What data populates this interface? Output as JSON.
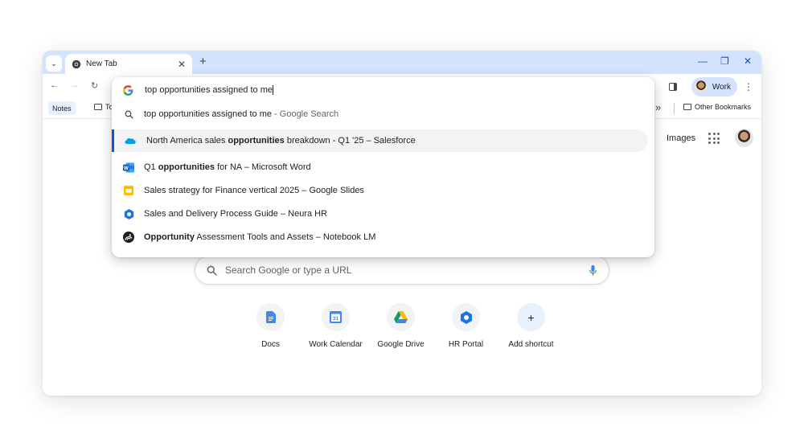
{
  "tabstrip": {
    "tab_title": "New Tab",
    "close_glyph": "✕",
    "new_tab_glyph": "+",
    "window_controls": [
      "—",
      "❐",
      "✕"
    ]
  },
  "toolbar": {
    "profile_label": "Work"
  },
  "bookmarks": {
    "notes_label": "Notes",
    "folder_partial": "To",
    "overflow": "»",
    "other_bookmarks": "Other Bookmarks"
  },
  "omnibox": {
    "query": "top opportunities assigned to me",
    "suggestions": [
      {
        "icon": "search-icon",
        "pre": "top opportunities assigned to me",
        "bold": "",
        "post": "",
        "source": " - Google Search"
      },
      {
        "icon": "salesforce-icon",
        "pre": "North America sales ",
        "bold": "opportunities",
        "post": " breakdown - Q1 '25",
        "source": " – Salesforce"
      },
      {
        "icon": "word-icon",
        "pre": "Q1 ",
        "bold": "opportunities",
        "post": " for NA",
        "source": " – Microsoft Word"
      },
      {
        "icon": "slides-icon",
        "pre": "Sales strategy for Finance vertical 2025",
        "bold": "",
        "post": "",
        "source": " – Google Slides"
      },
      {
        "icon": "neura-hr-icon",
        "pre": "Sales and Delivery Process Guide",
        "bold": "",
        "post": "",
        "source": " – Neura HR"
      },
      {
        "icon": "notebooklm-icon",
        "pre": "",
        "bold": "Opportunity",
        "post": " Assessment Tools and Assets",
        "source": " – Notebook LM"
      }
    ]
  },
  "ntp": {
    "images_link": "Images",
    "search_placeholder": "Search Google or type a URL",
    "shortcuts": [
      {
        "label": "Docs",
        "icon": "docs-icon"
      },
      {
        "label": "Work Calendar",
        "icon": "calendar-icon"
      },
      {
        "label": "Google Drive",
        "icon": "drive-icon"
      },
      {
        "label": "HR Portal",
        "icon": "hr-portal-icon"
      },
      {
        "label": "Add shortcut",
        "icon": "plus-icon"
      }
    ],
    "calendar_day": "31"
  },
  "colors": {
    "tabstrip_bg": "#d3e3fd",
    "accent": "#0b57d0",
    "salesforce": "#00a1e0",
    "word": "#185abd",
    "slides": "#fbbc04",
    "neura": "#1a73e8"
  }
}
